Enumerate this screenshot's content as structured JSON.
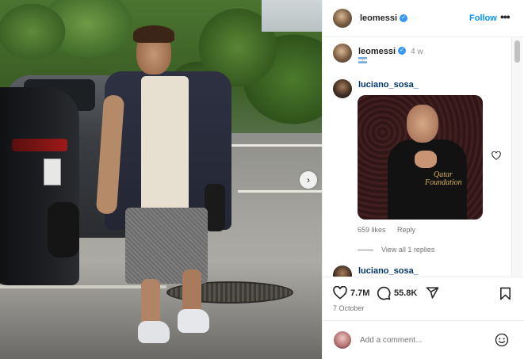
{
  "post": {
    "author": "leomessi",
    "follow_label": "Follow",
    "more_label": "•••",
    "caption_time": "4 w",
    "date": "7 October",
    "next_label": "›"
  },
  "comments": [
    {
      "user": "luciano_sosa_",
      "gif_text": "Qatar Foundation",
      "likes": "659 likes",
      "reply_label": "Reply",
      "view_replies": "View all 1 replies"
    },
    {
      "user": "luciano_sosa_"
    }
  ],
  "actions": {
    "likes_count": "7.7M",
    "comments_count": "55.8K"
  },
  "composer": {
    "placeholder": "Add a comment..."
  },
  "colors": {
    "accent": "#0095f6",
    "verified": "#3897f0",
    "username_link": "#00376b",
    "muted": "#737373"
  },
  "icons": [
    "verified-badge-icon",
    "more-icon",
    "heart-icon",
    "comment-icon",
    "share-icon",
    "bookmark-icon",
    "emoji-icon",
    "chevron-right-icon"
  ]
}
